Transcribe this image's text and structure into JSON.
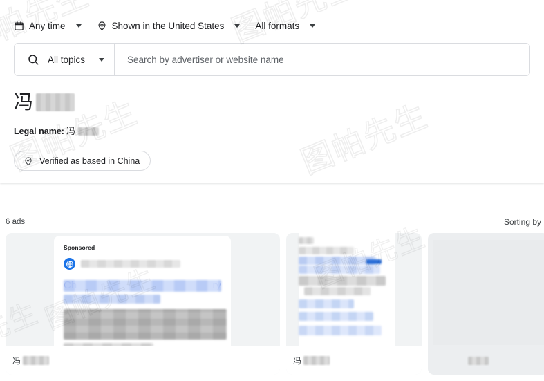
{
  "filters": [
    {
      "icon": "calendar-icon",
      "label": "Any time",
      "has_caret": true
    },
    {
      "icon": "location-pin-icon",
      "label": "Shown in the United States",
      "has_caret": true
    },
    {
      "icon": "",
      "label": "All formats",
      "has_caret": true
    }
  ],
  "search": {
    "topic_label": "All topics",
    "search_icon": "search-icon",
    "placeholder": "Search by advertiser or website name",
    "value": ""
  },
  "advertiser": {
    "name_visible": "冯",
    "name_redacted": true,
    "legal_label": "Legal name:",
    "legal_value_visible": "冯",
    "legal_redacted": true,
    "verified_icon": "verified-location-icon",
    "verified_label": "Verified as based in China"
  },
  "results": {
    "count_label": "6 ads",
    "sorting_label": "Sorting by m",
    "cards": [
      {
        "sponsored_label": "Sponsored",
        "favicon": "globe-icon",
        "headline_start": "Ch",
        "headline_end": "ry",
        "footer_visible": "冯",
        "redacted": true
      },
      {
        "sponsored_label": "",
        "favicon": "",
        "headline_start": "",
        "headline_end": "",
        "footer_visible": "冯",
        "redacted": true
      },
      {
        "sponsored_label": "",
        "favicon": "",
        "headline_start": "",
        "headline_end": "",
        "footer_visible": "",
        "redacted": true
      }
    ]
  },
  "watermark": {
    "text": "图帕先生"
  },
  "colors": {
    "accent_blue": "#1a73e8",
    "link_blue": "#2b4fd0",
    "text": "#202124",
    "muted": "#5f6368",
    "border": "#dadce0",
    "card_bg": "#f1f3f4"
  }
}
